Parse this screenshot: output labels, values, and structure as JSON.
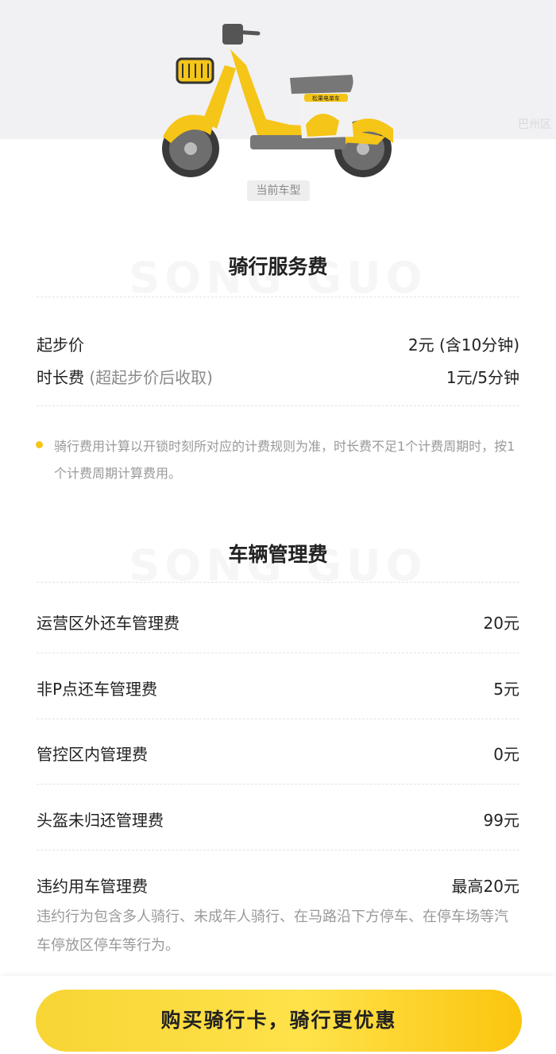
{
  "region_label": "巴州区",
  "current_model_label": "当前车型",
  "scooter_brand_text": "松果电单车",
  "ride_fee": {
    "watermark": "SONG GUO",
    "title": "骑行服务费",
    "items": [
      {
        "label": "起步价",
        "note": "",
        "value": "2元 (含10分钟)"
      },
      {
        "label": "时长费",
        "note": "(超起步价后收取)",
        "value": "1元/5分钟"
      }
    ],
    "tip": "骑行费用计算以开锁时刻所对应的计费规则为准，时长费不足1个计费周期时，按1个计费周期计算费用。"
  },
  "management_fee": {
    "watermark": "SONG GUO",
    "title": "车辆管理费",
    "items": [
      {
        "label": "运营区外还车管理费",
        "value": "20元"
      },
      {
        "label": "非P点还车管理费",
        "value": "5元"
      },
      {
        "label": "管控区内管理费",
        "value": "0元"
      },
      {
        "label": "头盔未归还管理费",
        "value": "99元"
      },
      {
        "label": "违约用车管理费",
        "value": "最高20元"
      }
    ],
    "violation_desc": "违约行为包含多人骑行、未成年人骑行、在马路沿下方停车、在停车场等汽车停放区停车等行为。"
  },
  "cta_label": "购买骑行卡，骑行更优惠",
  "colors": {
    "accent": "#F5C518",
    "button_start": "#F7D534",
    "button_end": "#FBC50E"
  }
}
